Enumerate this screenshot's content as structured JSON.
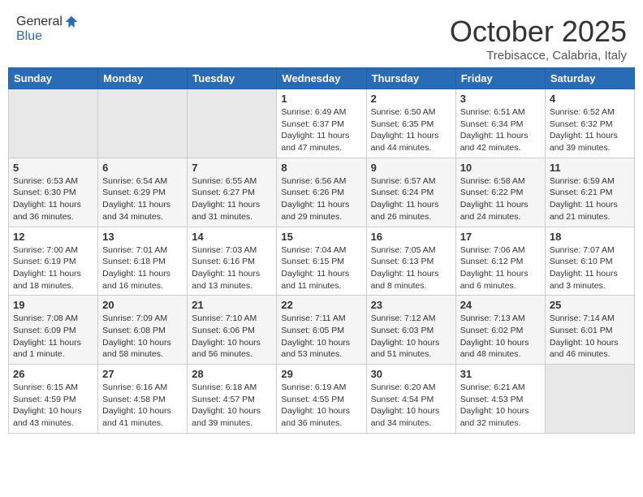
{
  "header": {
    "logo_line1": "General",
    "logo_line2": "Blue",
    "month": "October 2025",
    "location": "Trebisacce, Calabria, Italy"
  },
  "weekdays": [
    "Sunday",
    "Monday",
    "Tuesday",
    "Wednesday",
    "Thursday",
    "Friday",
    "Saturday"
  ],
  "weeks": [
    [
      {
        "day": "",
        "info": ""
      },
      {
        "day": "",
        "info": ""
      },
      {
        "day": "",
        "info": ""
      },
      {
        "day": "1",
        "info": "Sunrise: 6:49 AM\nSunset: 6:37 PM\nDaylight: 11 hours\nand 47 minutes."
      },
      {
        "day": "2",
        "info": "Sunrise: 6:50 AM\nSunset: 6:35 PM\nDaylight: 11 hours\nand 44 minutes."
      },
      {
        "day": "3",
        "info": "Sunrise: 6:51 AM\nSunset: 6:34 PM\nDaylight: 11 hours\nand 42 minutes."
      },
      {
        "day": "4",
        "info": "Sunrise: 6:52 AM\nSunset: 6:32 PM\nDaylight: 11 hours\nand 39 minutes."
      }
    ],
    [
      {
        "day": "5",
        "info": "Sunrise: 6:53 AM\nSunset: 6:30 PM\nDaylight: 11 hours\nand 36 minutes."
      },
      {
        "day": "6",
        "info": "Sunrise: 6:54 AM\nSunset: 6:29 PM\nDaylight: 11 hours\nand 34 minutes."
      },
      {
        "day": "7",
        "info": "Sunrise: 6:55 AM\nSunset: 6:27 PM\nDaylight: 11 hours\nand 31 minutes."
      },
      {
        "day": "8",
        "info": "Sunrise: 6:56 AM\nSunset: 6:26 PM\nDaylight: 11 hours\nand 29 minutes."
      },
      {
        "day": "9",
        "info": "Sunrise: 6:57 AM\nSunset: 6:24 PM\nDaylight: 11 hours\nand 26 minutes."
      },
      {
        "day": "10",
        "info": "Sunrise: 6:58 AM\nSunset: 6:22 PM\nDaylight: 11 hours\nand 24 minutes."
      },
      {
        "day": "11",
        "info": "Sunrise: 6:59 AM\nSunset: 6:21 PM\nDaylight: 11 hours\nand 21 minutes."
      }
    ],
    [
      {
        "day": "12",
        "info": "Sunrise: 7:00 AM\nSunset: 6:19 PM\nDaylight: 11 hours\nand 18 minutes."
      },
      {
        "day": "13",
        "info": "Sunrise: 7:01 AM\nSunset: 6:18 PM\nDaylight: 11 hours\nand 16 minutes."
      },
      {
        "day": "14",
        "info": "Sunrise: 7:03 AM\nSunset: 6:16 PM\nDaylight: 11 hours\nand 13 minutes."
      },
      {
        "day": "15",
        "info": "Sunrise: 7:04 AM\nSunset: 6:15 PM\nDaylight: 11 hours\nand 11 minutes."
      },
      {
        "day": "16",
        "info": "Sunrise: 7:05 AM\nSunset: 6:13 PM\nDaylight: 11 hours\nand 8 minutes."
      },
      {
        "day": "17",
        "info": "Sunrise: 7:06 AM\nSunset: 6:12 PM\nDaylight: 11 hours\nand 6 minutes."
      },
      {
        "day": "18",
        "info": "Sunrise: 7:07 AM\nSunset: 6:10 PM\nDaylight: 11 hours\nand 3 minutes."
      }
    ],
    [
      {
        "day": "19",
        "info": "Sunrise: 7:08 AM\nSunset: 6:09 PM\nDaylight: 11 hours\nand 1 minute."
      },
      {
        "day": "20",
        "info": "Sunrise: 7:09 AM\nSunset: 6:08 PM\nDaylight: 10 hours\nand 58 minutes."
      },
      {
        "day": "21",
        "info": "Sunrise: 7:10 AM\nSunset: 6:06 PM\nDaylight: 10 hours\nand 56 minutes."
      },
      {
        "day": "22",
        "info": "Sunrise: 7:11 AM\nSunset: 6:05 PM\nDaylight: 10 hours\nand 53 minutes."
      },
      {
        "day": "23",
        "info": "Sunrise: 7:12 AM\nSunset: 6:03 PM\nDaylight: 10 hours\nand 51 minutes."
      },
      {
        "day": "24",
        "info": "Sunrise: 7:13 AM\nSunset: 6:02 PM\nDaylight: 10 hours\nand 48 minutes."
      },
      {
        "day": "25",
        "info": "Sunrise: 7:14 AM\nSunset: 6:01 PM\nDaylight: 10 hours\nand 46 minutes."
      }
    ],
    [
      {
        "day": "26",
        "info": "Sunrise: 6:15 AM\nSunset: 4:59 PM\nDaylight: 10 hours\nand 43 minutes."
      },
      {
        "day": "27",
        "info": "Sunrise: 6:16 AM\nSunset: 4:58 PM\nDaylight: 10 hours\nand 41 minutes."
      },
      {
        "day": "28",
        "info": "Sunrise: 6:18 AM\nSunset: 4:57 PM\nDaylight: 10 hours\nand 39 minutes."
      },
      {
        "day": "29",
        "info": "Sunrise: 6:19 AM\nSunset: 4:55 PM\nDaylight: 10 hours\nand 36 minutes."
      },
      {
        "day": "30",
        "info": "Sunrise: 6:20 AM\nSunset: 4:54 PM\nDaylight: 10 hours\nand 34 minutes."
      },
      {
        "day": "31",
        "info": "Sunrise: 6:21 AM\nSunset: 4:53 PM\nDaylight: 10 hours\nand 32 minutes."
      },
      {
        "day": "",
        "info": ""
      }
    ]
  ]
}
